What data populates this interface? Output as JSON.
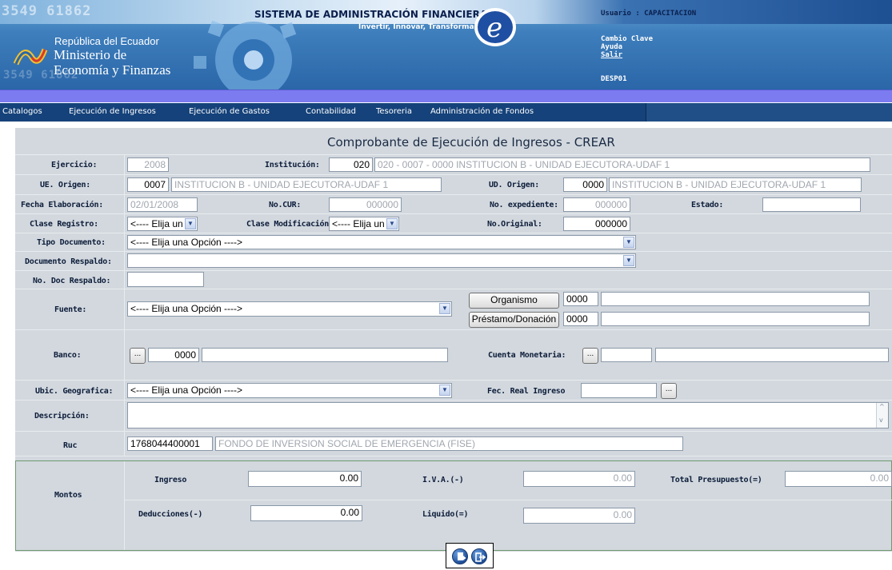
{
  "header": {
    "bg_digits": "3549 61862",
    "system_title": "SISTEMA DE ADMINISTRACIÓN FINANCIERA",
    "slogan": "Invertir, Innovar, Transformarse...",
    "ministry_line1": "República del Ecuador",
    "ministry_line2": "Ministerio de",
    "ministry_line3": "Economía y Finanzas",
    "user_label": "Usuario : CAPACITACION",
    "link_change_password": "Cambio Clave",
    "link_help": "Ayuda",
    "link_logout": "Salir",
    "session_code": "DESP01"
  },
  "menu": {
    "items": [
      "Catalogos",
      "Ejecución de Ingresos",
      "Ejecución de Gastos",
      "Contabilidad",
      "Tesoreria",
      "Administración de Fondos"
    ]
  },
  "form": {
    "title": "Comprobante de Ejecución de Ingresos - CREAR",
    "ejercicio": {
      "label": "Ejercicio:",
      "value": "2008"
    },
    "institucion": {
      "label": "Institución:",
      "code": "020",
      "desc": "020 - 0007 - 0000 INSTITUCION B - UNIDAD EJECUTORA-UDAF 1"
    },
    "ue_origen": {
      "label": "UE. Origen:",
      "code": "0007",
      "desc": "INSTITUCION B - UNIDAD EJECUTORA-UDAF 1"
    },
    "ud_origen": {
      "label": "UD. Origen:",
      "code": "0000",
      "desc": "INSTITUCION B - UNIDAD EJECUTORA-UDAF 1"
    },
    "fecha_elaboracion": {
      "label": "Fecha Elaboración:",
      "value": "02/01/2008"
    },
    "no_cur": {
      "label": "No.CUR:",
      "value": "000000"
    },
    "no_expediente": {
      "label": "No. expediente:",
      "value": "000000"
    },
    "estado": {
      "label": "Estado:",
      "value": ""
    },
    "clase_registro": {
      "label": "Clase Registro:",
      "value": "<---- Elija un"
    },
    "clase_modificacion": {
      "label": "Clase Modificación:",
      "value": "<---- Elija un"
    },
    "no_original": {
      "label": "No.Original:",
      "value": "000000"
    },
    "tipo_documento": {
      "label": "Tipo Documento:",
      "value": "<---- Elija una Opción ---->"
    },
    "documento_respaldo": {
      "label": "Documento Respaldo:",
      "value": ""
    },
    "no_doc_respaldo": {
      "label": "No. Doc Respaldo:",
      "value": ""
    },
    "fuente": {
      "label": "Fuente:",
      "value": "<---- Elija una Opción ---->"
    },
    "organismo": {
      "button": "Organismo",
      "code": "0000",
      "desc": ""
    },
    "prestamo": {
      "button": "Préstamo/Donación",
      "code": "0000",
      "desc": ""
    },
    "banco": {
      "label": "Banco:",
      "button": "...",
      "code": "0000",
      "desc": ""
    },
    "cuenta_monetaria": {
      "label": "Cuenta Monetaria:",
      "button": "...",
      "code": "",
      "desc": ""
    },
    "ubic_geografica": {
      "label": "Ubic. Geografica:",
      "value": "<---- Elija una Opción ---->"
    },
    "fec_real_ingreso": {
      "label": "Fec. Real Ingreso",
      "value": "",
      "button": "..."
    },
    "descripcion": {
      "label": "Descripción:",
      "value": ""
    },
    "ruc": {
      "label": "Ruc",
      "value": "1768044400001",
      "name": "FONDO DE INVERSION SOCIAL DE EMERGENCIA (FISE)"
    }
  },
  "montos": {
    "label": "Montos",
    "ingreso": {
      "label": "Ingreso",
      "value": "0.00"
    },
    "iva": {
      "label": "I.V.A.(-)",
      "value": "0.00"
    },
    "total_presupuesto": {
      "label": "Total Presupuesto(=)",
      "value": "0.00"
    },
    "deducciones": {
      "label": "Deducciones(-)",
      "value": "0.00"
    },
    "liquido": {
      "label": "Liquido(=)",
      "value": "0.00"
    }
  },
  "footer": {
    "icons": [
      "new-document-icon",
      "exit-icon"
    ]
  },
  "colors": {
    "header_blue": "#2a66a8",
    "menu_blue": "#15427a",
    "purple_bar": "#7c7cf0",
    "form_gray": "#d2d8de",
    "montos_border": "#6f9a6f"
  }
}
